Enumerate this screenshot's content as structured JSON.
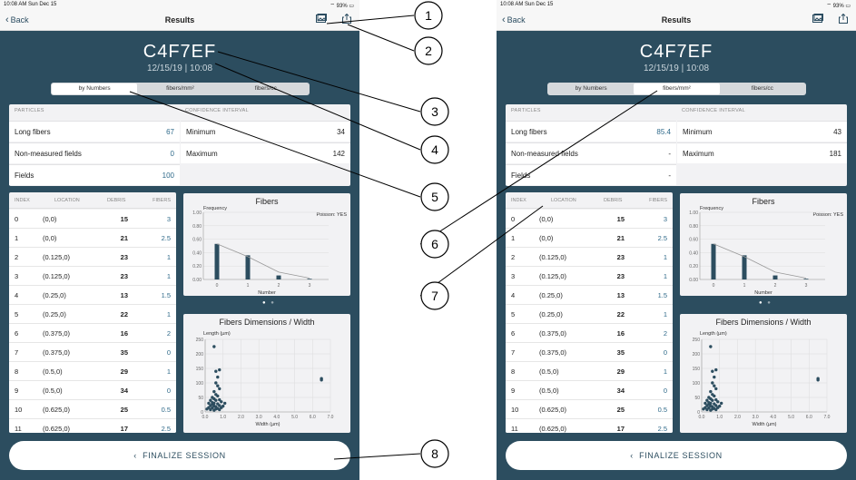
{
  "screens": [
    {
      "status": {
        "time_label": "10:08 AM  Sun Dec 15",
        "battery": "93%"
      },
      "nav": {
        "back": "Back",
        "title": "Results"
      },
      "session": {
        "id": "C4F7EF",
        "date": "12/15/19 | 10:08"
      },
      "tabs": [
        "by Numbers",
        "fibers/mm²",
        "fibers/cc"
      ],
      "active_tab": 0,
      "particles": {
        "header": "PARTICLES",
        "rows": [
          {
            "label": "Long fibers",
            "value": "67"
          },
          {
            "label": "Non-measured fields",
            "value": "0"
          },
          {
            "label": "Fields",
            "value": "100"
          }
        ]
      },
      "confidence": {
        "header": "CONFIDENCE INTERVAL",
        "rows": [
          {
            "label": "Minimum",
            "value": "34"
          },
          {
            "label": "Maximum",
            "value": "142"
          }
        ]
      },
      "finalize": "FINALIZE SESSION"
    },
    {
      "status": {
        "time_label": "10:08 AM  Sun Dec 15",
        "battery": "93%"
      },
      "nav": {
        "back": "Back",
        "title": "Results"
      },
      "session": {
        "id": "C4F7EF",
        "date": "12/15/19 | 10:08"
      },
      "tabs": [
        "by Numbers",
        "fibers/mm²",
        "fibers/cc"
      ],
      "active_tab": 1,
      "particles": {
        "header": "PARTICLES",
        "rows": [
          {
            "label": "Long fibers",
            "value": "85.4"
          },
          {
            "label": "Non-measured fields",
            "value": "-"
          },
          {
            "label": "Fields",
            "value": "-"
          }
        ]
      },
      "confidence": {
        "header": "CONFIDENCE INTERVAL",
        "rows": [
          {
            "label": "Minimum",
            "value": "43"
          },
          {
            "label": "Maximum",
            "value": "181"
          }
        ]
      },
      "finalize": "FINALIZE SESSION"
    }
  ],
  "table": {
    "headers": [
      "INDEX",
      "LOCATION",
      "DEBRIS",
      "FIBERS"
    ],
    "rows": [
      [
        "0",
        "(0,0)",
        "15",
        "3"
      ],
      [
        "1",
        "(0,0)",
        "21",
        "2.5"
      ],
      [
        "2",
        "(0.125,0)",
        "23",
        "1"
      ],
      [
        "3",
        "(0.125,0)",
        "23",
        "1"
      ],
      [
        "4",
        "(0.25,0)",
        "13",
        "1.5"
      ],
      [
        "5",
        "(0.25,0)",
        "22",
        "1"
      ],
      [
        "6",
        "(0.375,0)",
        "16",
        "2"
      ],
      [
        "7",
        "(0.375,0)",
        "35",
        "0"
      ],
      [
        "8",
        "(0.5,0)",
        "29",
        "1"
      ],
      [
        "9",
        "(0.5,0)",
        "34",
        "0"
      ],
      [
        "10",
        "(0.625,0)",
        "25",
        "0.5"
      ],
      [
        "11",
        "(0.625,0)",
        "17",
        "2.5"
      ]
    ]
  },
  "chart_data": [
    {
      "type": "bar",
      "title": "Fibers",
      "annotation": "Poisson: YES",
      "ylabel": "Frequency",
      "xlabel": "Number",
      "categories": [
        "0",
        "1",
        "2",
        "3"
      ],
      "values": [
        0.53,
        0.36,
        0.06,
        0.01
      ],
      "poisson_line": [
        0.53,
        0.34,
        0.11,
        0.02
      ],
      "ylim": [
        0,
        1.0
      ],
      "yticks": [
        "1.00",
        "0.80",
        "0.60",
        "0.40",
        "0.20",
        "0.00"
      ],
      "colors": {
        "bar": "#2c4d5f",
        "line": "#999999"
      }
    },
    {
      "type": "scatter",
      "title": "Fibers Dimensions / Width",
      "ylabel": "Length (µm)",
      "xlabel": "Width (µm)",
      "xlim": [
        0,
        7.0
      ],
      "ylim": [
        0,
        250
      ],
      "xticks": [
        "0.0",
        "1.0",
        "2.0",
        "3.0",
        "4.0",
        "5.0",
        "6.0",
        "7.0"
      ],
      "yticks": [
        "250",
        "200",
        "150",
        "100",
        "50",
        "0"
      ],
      "points": [
        [
          0.5,
          225
        ],
        [
          0.6,
          140
        ],
        [
          0.8,
          145
        ],
        [
          0.7,
          120
        ],
        [
          0.6,
          100
        ],
        [
          0.7,
          90
        ],
        [
          0.8,
          80
        ],
        [
          0.5,
          70
        ],
        [
          0.6,
          60
        ],
        [
          0.7,
          55
        ],
        [
          0.4,
          50
        ],
        [
          0.5,
          45
        ],
        [
          0.3,
          40
        ],
        [
          0.6,
          40
        ],
        [
          0.8,
          42
        ],
        [
          0.2,
          30
        ],
        [
          0.4,
          32
        ],
        [
          0.5,
          30
        ],
        [
          0.7,
          28
        ],
        [
          0.9,
          35
        ],
        [
          0.3,
          22
        ],
        [
          0.5,
          20
        ],
        [
          0.6,
          18
        ],
        [
          0.8,
          22
        ],
        [
          0.2,
          15
        ],
        [
          0.4,
          14
        ],
        [
          0.7,
          12
        ],
        [
          0.9,
          15
        ],
        [
          0.1,
          10
        ],
        [
          0.3,
          8
        ],
        [
          0.5,
          6
        ],
        [
          0.6,
          10
        ],
        [
          0.8,
          8
        ],
        [
          1.0,
          20
        ],
        [
          1.1,
          30
        ],
        [
          0.4,
          26
        ],
        [
          6.5,
          110
        ],
        [
          6.5,
          115
        ]
      ],
      "colors": {
        "point": "#2c4d5f"
      }
    }
  ],
  "callouts": [
    "1",
    "2",
    "3",
    "4",
    "5",
    "6",
    "7",
    "8"
  ]
}
